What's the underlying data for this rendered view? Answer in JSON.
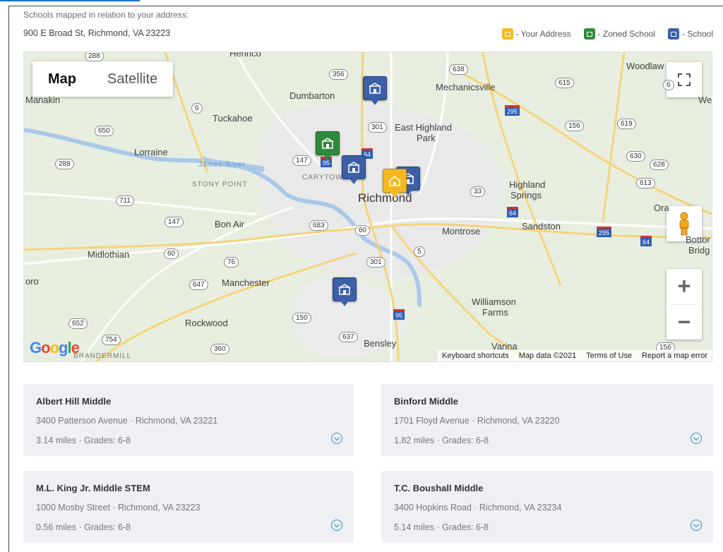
{
  "header": {
    "intro": "Schools mapped in relation to your address:",
    "address": "900 E Broad St, Richmond, VA 23223"
  },
  "legend": [
    {
      "label": "- Your Address",
      "color": "#f4b81f",
      "icon": "home-icon"
    },
    {
      "label": "- Zoned School",
      "color": "#2e8b3c",
      "icon": "school-icon"
    },
    {
      "label": "- School",
      "color": "#3c5fa8",
      "icon": "school-icon"
    }
  ],
  "map": {
    "type_controls": {
      "map": "Map",
      "satellite": "Satellite"
    },
    "zoom_in": "+",
    "zoom_out": "−",
    "google_logo": "Google",
    "attribution": {
      "shortcuts": "Keyboard shortcuts",
      "data": "Map data ©2021",
      "terms": "Terms of Use",
      "report": "Report a map error"
    },
    "place_labels": {
      "richmond": "Richmond",
      "mechanicsville": "Mechanicsville",
      "dumbarton": "Dumbarton",
      "tuckahoe": "Tuckahoe",
      "east_highland_park_1": "East Highland",
      "east_highland_park_2": "Park",
      "lorraine": "Lorraine",
      "stony_point": "STONY POINT",
      "carytown": "CARYTOWN",
      "james_river": "James River",
      "highland_springs_1": "Highland",
      "highland_springs_2": "Springs",
      "bon_air": "Bon Air",
      "montrose": "Montrose",
      "sandston": "Sandston",
      "midlothian": "Midlothian",
      "manchester": "Manchester",
      "williamson_farms_1": "Williamson",
      "williamson_farms_2": "Farms",
      "rockwood": "Rockwood",
      "bensley": "Bensley",
      "varina": "Varina",
      "woodlawn": "Woodlaw",
      "manakin": "Manakin",
      "henrico": "Henrico",
      "oro": "oro",
      "bottoms_bridge_1": "Bottor",
      "bottoms_bridge_2": "Bridg",
      "ora": "Ora",
      "brandermill": "BRANDERMILL",
      "we": "We"
    },
    "route_shields": [
      "288",
      "356",
      "638",
      "615",
      "6",
      "650",
      "156",
      "619",
      "288",
      "147",
      "301",
      "630",
      "628",
      "613",
      "711",
      "33",
      "147",
      "683",
      "60",
      "5",
      "60",
      "76",
      "301",
      "647",
      "150",
      "652",
      "754",
      "637",
      "360",
      "64",
      "295",
      "295",
      "64",
      "95",
      "95",
      "64",
      "156",
      "6"
    ]
  },
  "schools": [
    {
      "name": "Albert Hill Middle",
      "street": "3400 Patterson Avenue",
      "city": "Richmond, VA 23221",
      "distance": "3.14 miles",
      "grades": "Grades: 6-8"
    },
    {
      "name": "Binford Middle",
      "street": "1701 Floyd Avenue",
      "city": "Richmond, VA 23220",
      "distance": "1.82 miles",
      "grades": "Grades: 6-8"
    },
    {
      "name": "M.L. King Jr. Middle STEM",
      "street": "1000 Mosby Street",
      "city": "Richmond, VA 23223",
      "distance": "0.56 miles",
      "grades": "Grades: 6-8"
    },
    {
      "name": "T.C. Boushall Middle",
      "street": "3400 Hopkins Road",
      "city": "Richmond, VA 23234",
      "distance": "5.14 miles",
      "grades": "Grades: 6-8"
    }
  ],
  "separator": " · "
}
